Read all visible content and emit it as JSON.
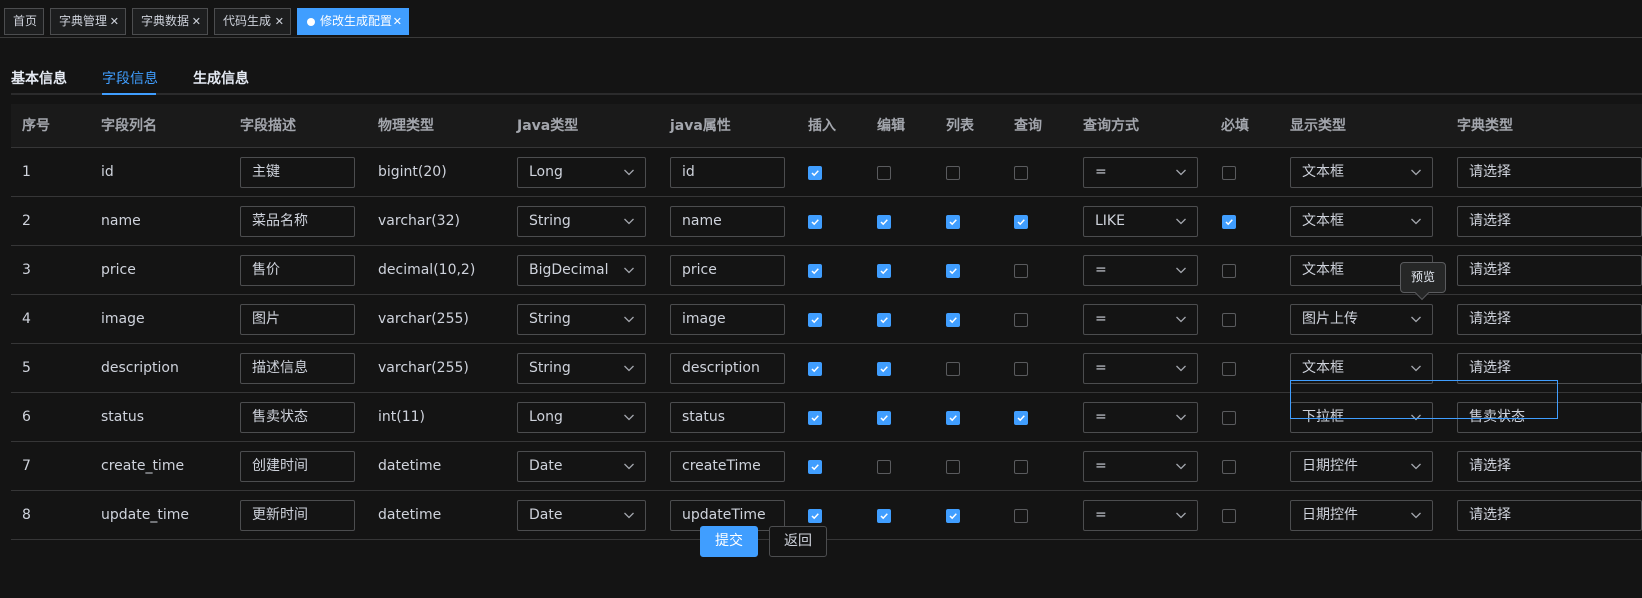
{
  "tags": [
    {
      "label": "首页",
      "closable": false
    },
    {
      "label": "字典管理",
      "closable": true
    },
    {
      "label": "字典数据",
      "closable": true
    },
    {
      "label": "代码生成",
      "closable": true
    },
    {
      "label": "修改生成配置",
      "closable": true,
      "active": true
    }
  ],
  "tabs": [
    {
      "label": "基本信息"
    },
    {
      "label": "字段信息",
      "active": true
    },
    {
      "label": "生成信息"
    }
  ],
  "table": {
    "headers": [
      "序号",
      "字段列名",
      "字段描述",
      "物理类型",
      "Java类型",
      "java属性",
      "插入",
      "编辑",
      "列表",
      "查询",
      "查询方式",
      "必填",
      "显示类型",
      "字典类型"
    ],
    "rows": [
      {
        "index": "1",
        "column": "id",
        "desc": "主键",
        "physical": "bigint(20)",
        "java_type": "Long",
        "java_field": "id",
        "insert": true,
        "edit": false,
        "list": false,
        "query": false,
        "query_type": "=",
        "required": false,
        "display": "文本框",
        "dict": "请选择"
      },
      {
        "index": "2",
        "column": "name",
        "desc": "菜品名称",
        "physical": "varchar(32)",
        "java_type": "String",
        "java_field": "name",
        "insert": true,
        "edit": true,
        "list": true,
        "query": true,
        "query_type": "LIKE",
        "required": true,
        "display": "文本框",
        "dict": "请选择"
      },
      {
        "index": "3",
        "column": "price",
        "desc": "售价",
        "physical": "decimal(10,2)",
        "java_type": "BigDecimal",
        "java_field": "price",
        "insert": true,
        "edit": true,
        "list": true,
        "query": false,
        "query_type": "=",
        "required": false,
        "display": "文本框",
        "dict": "请选择"
      },
      {
        "index": "4",
        "column": "image",
        "desc": "图片",
        "physical": "varchar(255)",
        "java_type": "String",
        "java_field": "image",
        "insert": true,
        "edit": true,
        "list": true,
        "query": false,
        "query_type": "=",
        "required": false,
        "display": "图片上传",
        "dict": "请选择"
      },
      {
        "index": "5",
        "column": "description",
        "desc": "描述信息",
        "physical": "varchar(255)",
        "java_type": "String",
        "java_field": "description",
        "insert": true,
        "edit": true,
        "list": false,
        "query": false,
        "query_type": "=",
        "required": false,
        "display": "文本框",
        "dict": "请选择"
      },
      {
        "index": "6",
        "column": "status",
        "desc": "售卖状态",
        "physical": "int(11)",
        "java_type": "Long",
        "java_field": "status",
        "insert": true,
        "edit": true,
        "list": true,
        "query": true,
        "query_type": "=",
        "required": false,
        "display": "下拉框",
        "dict": "售卖状态"
      },
      {
        "index": "7",
        "column": "create_time",
        "desc": "创建时间",
        "physical": "datetime",
        "java_type": "Date",
        "java_field": "createTime",
        "insert": true,
        "edit": false,
        "list": false,
        "query": false,
        "query_type": "=",
        "required": false,
        "display": "日期控件",
        "dict": "请选择"
      },
      {
        "index": "8",
        "column": "update_time",
        "desc": "更新时间",
        "physical": "datetime",
        "java_type": "Date",
        "java_field": "updateTime",
        "insert": true,
        "edit": true,
        "list": true,
        "query": false,
        "query_type": "=",
        "required": false,
        "display": "日期控件",
        "dict": "请选择"
      }
    ]
  },
  "tooltip": {
    "text": "预览"
  },
  "actions": {
    "submit": "提交",
    "back": "返回"
  },
  "colors": {
    "accent": "#409eff",
    "background": "#141414",
    "border": "#4c4d4f"
  },
  "icons": [
    "close-icon",
    "chevron-down-icon",
    "checkmark-icon",
    "dot-icon"
  ]
}
